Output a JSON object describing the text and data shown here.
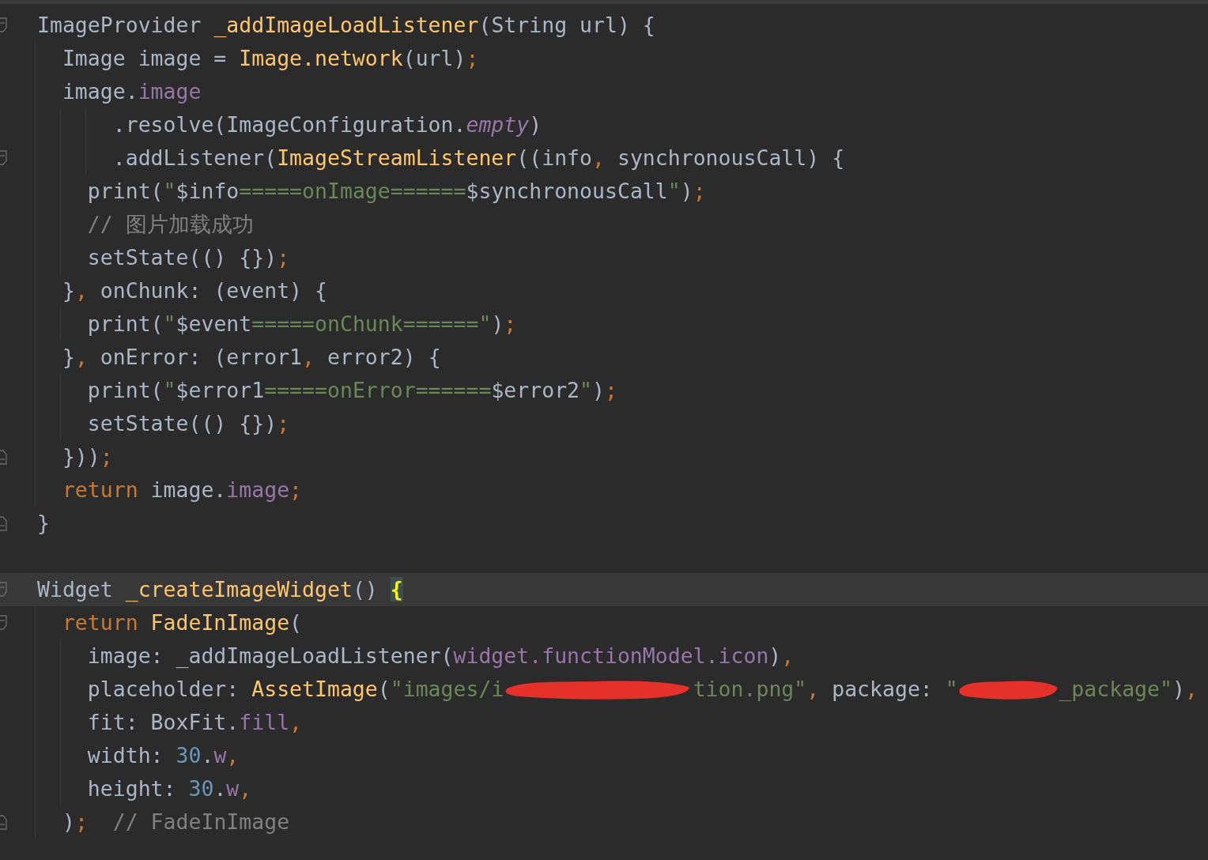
{
  "editor": {
    "lines": [
      {
        "kind": "code",
        "current": false,
        "fold_start": true,
        "fold_end": false,
        "tokens": [
          {
            "text": "ImageProvider ",
            "kind": "plain"
          },
          {
            "text": "_addImageLoadListener",
            "kind": "function"
          },
          {
            "text": "(String url) {",
            "kind": "plain"
          }
        ]
      },
      {
        "kind": "code",
        "current": false,
        "fold_start": false,
        "fold_end": false,
        "tokens": [
          {
            "text": "  Image image = ",
            "kind": "plain"
          },
          {
            "text": "Image.network",
            "kind": "function"
          },
          {
            "text": "(url)",
            "kind": "plain"
          },
          {
            "text": ";",
            "kind": "keyword"
          }
        ]
      },
      {
        "kind": "code",
        "current": false,
        "fold_start": false,
        "fold_end": false,
        "tokens": [
          {
            "text": "  image.",
            "kind": "plain"
          },
          {
            "text": "image",
            "kind": "field"
          }
        ]
      },
      {
        "kind": "code",
        "current": false,
        "fold_start": false,
        "fold_end": false,
        "tokens": [
          {
            "text": "      .resolve(ImageConfiguration.",
            "kind": "plain"
          },
          {
            "text": "empty",
            "kind": "constant"
          },
          {
            "text": ")",
            "kind": "plain"
          }
        ]
      },
      {
        "kind": "code",
        "current": false,
        "fold_start": true,
        "fold_end": false,
        "tokens": [
          {
            "text": "      .addListener(",
            "kind": "plain"
          },
          {
            "text": "ImageStreamListener",
            "kind": "function"
          },
          {
            "text": "((info",
            "kind": "plain"
          },
          {
            "text": ",",
            "kind": "keyword"
          },
          {
            "text": " synchronousCall) {",
            "kind": "plain"
          }
        ]
      },
      {
        "kind": "code",
        "current": false,
        "fold_start": false,
        "fold_end": false,
        "tokens": [
          {
            "text": "    print(",
            "kind": "plain"
          },
          {
            "text": "\"",
            "kind": "string"
          },
          {
            "text": "$info",
            "kind": "plain"
          },
          {
            "text": "=====onImage======",
            "kind": "string"
          },
          {
            "text": "$synchronousCall",
            "kind": "plain"
          },
          {
            "text": "\"",
            "kind": "string"
          },
          {
            "text": ")",
            "kind": "plain"
          },
          {
            "text": ";",
            "kind": "keyword"
          }
        ]
      },
      {
        "kind": "code",
        "current": false,
        "fold_start": false,
        "fold_end": false,
        "tokens": [
          {
            "text": "    // 图片加载成功",
            "kind": "comment"
          }
        ]
      },
      {
        "kind": "code",
        "current": false,
        "fold_start": false,
        "fold_end": false,
        "tokens": [
          {
            "text": "    setState(() {})",
            "kind": "plain"
          },
          {
            "text": ";",
            "kind": "keyword"
          }
        ]
      },
      {
        "kind": "code",
        "current": false,
        "fold_start": false,
        "fold_end": false,
        "tokens": [
          {
            "text": "  }",
            "kind": "plain"
          },
          {
            "text": ",",
            "kind": "keyword"
          },
          {
            "text": " onChunk: (event) {",
            "kind": "plain"
          }
        ]
      },
      {
        "kind": "code",
        "current": false,
        "fold_start": false,
        "fold_end": false,
        "tokens": [
          {
            "text": "    print(",
            "kind": "plain"
          },
          {
            "text": "\"",
            "kind": "string"
          },
          {
            "text": "$event",
            "kind": "plain"
          },
          {
            "text": "=====onChunk======\"",
            "kind": "string"
          },
          {
            "text": ")",
            "kind": "plain"
          },
          {
            "text": ";",
            "kind": "keyword"
          }
        ]
      },
      {
        "kind": "code",
        "current": false,
        "fold_start": false,
        "fold_end": false,
        "tokens": [
          {
            "text": "  }",
            "kind": "plain"
          },
          {
            "text": ",",
            "kind": "keyword"
          },
          {
            "text": " onError: (error1",
            "kind": "plain"
          },
          {
            "text": ",",
            "kind": "keyword"
          },
          {
            "text": " error2) {",
            "kind": "plain"
          }
        ]
      },
      {
        "kind": "code",
        "current": false,
        "fold_start": false,
        "fold_end": false,
        "tokens": [
          {
            "text": "    print(",
            "kind": "plain"
          },
          {
            "text": "\"",
            "kind": "string"
          },
          {
            "text": "$error1",
            "kind": "plain"
          },
          {
            "text": "=====onError======",
            "kind": "string"
          },
          {
            "text": "$error2",
            "kind": "plain"
          },
          {
            "text": "\"",
            "kind": "string"
          },
          {
            "text": ")",
            "kind": "plain"
          },
          {
            "text": ";",
            "kind": "keyword"
          }
        ]
      },
      {
        "kind": "code",
        "current": false,
        "fold_start": false,
        "fold_end": false,
        "tokens": [
          {
            "text": "    setState(() {})",
            "kind": "plain"
          },
          {
            "text": ";",
            "kind": "keyword"
          }
        ]
      },
      {
        "kind": "code",
        "current": false,
        "fold_start": false,
        "fold_end": true,
        "tokens": [
          {
            "text": "  }))",
            "kind": "plain"
          },
          {
            "text": ";",
            "kind": "keyword"
          }
        ]
      },
      {
        "kind": "code",
        "current": false,
        "fold_start": false,
        "fold_end": false,
        "tokens": [
          {
            "text": "  return",
            "kind": "keyword"
          },
          {
            "text": " image.",
            "kind": "plain"
          },
          {
            "text": "image",
            "kind": "field"
          },
          {
            "text": ";",
            "kind": "keyword"
          }
        ]
      },
      {
        "kind": "code",
        "current": false,
        "fold_start": false,
        "fold_end": true,
        "tokens": [
          {
            "text": "}",
            "kind": "plain"
          }
        ]
      },
      {
        "kind": "blank",
        "current": false,
        "fold_start": false,
        "fold_end": false
      },
      {
        "kind": "code",
        "current": true,
        "fold_start": true,
        "fold_end": false,
        "tokens": [
          {
            "text": "Widget ",
            "kind": "plain"
          },
          {
            "text": "_createImageWidget",
            "kind": "function"
          },
          {
            "text": "() ",
            "kind": "plain"
          },
          {
            "text": "{",
            "kind": "brace-match"
          }
        ]
      },
      {
        "kind": "code",
        "current": false,
        "fold_start": true,
        "fold_end": false,
        "tokens": [
          {
            "text": "  return",
            "kind": "keyword"
          },
          {
            "text": " FadeInImage",
            "kind": "function"
          },
          {
            "text": "(",
            "kind": "plain"
          }
        ]
      },
      {
        "kind": "code",
        "current": false,
        "fold_start": false,
        "fold_end": false,
        "tokens": [
          {
            "text": "    image: _addImageLoadListener(",
            "kind": "plain"
          },
          {
            "text": "widget.functionModel.icon",
            "kind": "field"
          },
          {
            "text": ")",
            "kind": "plain"
          },
          {
            "text": ",",
            "kind": "keyword"
          }
        ]
      },
      {
        "kind": "code",
        "current": false,
        "fold_start": false,
        "fold_end": false,
        "tokens": [
          {
            "text": "    placeholder: ",
            "kind": "plain"
          },
          {
            "text": "AssetImage",
            "kind": "function"
          },
          {
            "text": "(",
            "kind": "plain"
          },
          {
            "text": "\"images/i",
            "kind": "string"
          },
          {
            "kind": "redacted-long"
          },
          {
            "text": "tion.png\"",
            "kind": "string"
          },
          {
            "text": ",",
            "kind": "keyword"
          },
          {
            "text": " package: ",
            "kind": "plain"
          },
          {
            "text": "\"",
            "kind": "string"
          },
          {
            "kind": "redacted-short"
          },
          {
            "text": "_package\"",
            "kind": "string"
          },
          {
            "text": ")",
            "kind": "plain"
          },
          {
            "text": ",",
            "kind": "keyword"
          }
        ]
      },
      {
        "kind": "code",
        "current": false,
        "fold_start": false,
        "fold_end": false,
        "tokens": [
          {
            "text": "    fit: BoxFit.",
            "kind": "plain"
          },
          {
            "text": "fill",
            "kind": "field"
          },
          {
            "text": ",",
            "kind": "keyword"
          }
        ]
      },
      {
        "kind": "code",
        "current": false,
        "fold_start": false,
        "fold_end": false,
        "tokens": [
          {
            "text": "    width: ",
            "kind": "plain"
          },
          {
            "text": "30",
            "kind": "number"
          },
          {
            "text": ".",
            "kind": "plain"
          },
          {
            "text": "w",
            "kind": "field"
          },
          {
            "text": ",",
            "kind": "keyword"
          }
        ]
      },
      {
        "kind": "code",
        "current": false,
        "fold_start": false,
        "fold_end": false,
        "tokens": [
          {
            "text": "    height: ",
            "kind": "plain"
          },
          {
            "text": "30",
            "kind": "number"
          },
          {
            "text": ".",
            "kind": "plain"
          },
          {
            "text": "w",
            "kind": "field"
          },
          {
            "text": ",",
            "kind": "keyword"
          }
        ]
      },
      {
        "kind": "code",
        "current": false,
        "fold_start": false,
        "fold_end": true,
        "tokens": [
          {
            "text": "  )",
            "kind": "plain"
          },
          {
            "text": ";",
            "kind": "keyword"
          },
          {
            "text": "  // FadeInImage",
            "kind": "comment"
          }
        ]
      }
    ]
  }
}
